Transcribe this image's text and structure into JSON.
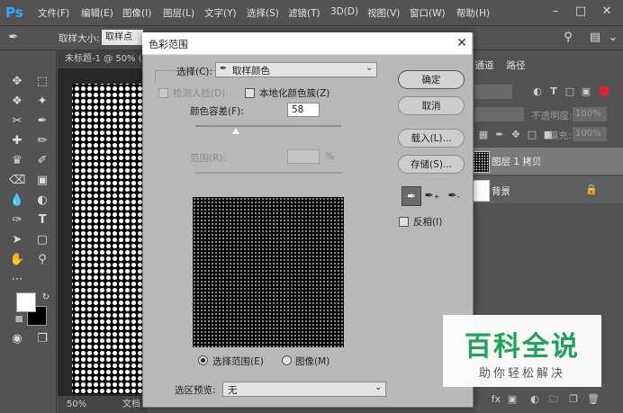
{
  "app": {
    "logo": "Ps"
  },
  "menubar": {
    "items": [
      "文件(F)",
      "编辑(E)",
      "图像(I)",
      "图层(L)",
      "文字(Y)",
      "选择(S)",
      "滤镜(T)",
      "3D(D)",
      "视图(V)",
      "窗口(W)",
      "帮助(H)"
    ]
  },
  "optionsbar": {
    "sample_size_label": "取样大小:",
    "sample_size_value": "取样点"
  },
  "document": {
    "tab_title": "未标题-1 @ 50% (",
    "zoom": "50%",
    "status": "文档"
  },
  "panels": {
    "tabs": [
      "通道",
      "路径"
    ],
    "opacity_label": "不透明度:",
    "opacity_value": "100%",
    "fill_label": "填充:",
    "fill_value": "100%",
    "layers": [
      {
        "name": "图层 1 拷贝"
      },
      {
        "name": "背景"
      }
    ]
  },
  "dialog": {
    "title": "色彩范围",
    "select_label": "选择(C):",
    "select_value": "取样颜色",
    "detect_faces_label": "检测人脸(D)",
    "localized_label": "本地化颜色簇(Z)",
    "fuzziness_label": "颜色容差(F):",
    "fuzziness_value": "58",
    "range_label": "范围(R):",
    "range_unit": "%",
    "buttons": {
      "ok": "确定",
      "cancel": "取消",
      "load": "载入(L)...",
      "save": "存储(S)..."
    },
    "invert_label": "反相(I)",
    "radio_selection": "选择范围(E)",
    "radio_image": "图像(M)",
    "preview_label": "选区预览:",
    "preview_value": "无"
  },
  "watermark": {
    "title": "百科全说",
    "subtitle": "助你轻松解决"
  }
}
